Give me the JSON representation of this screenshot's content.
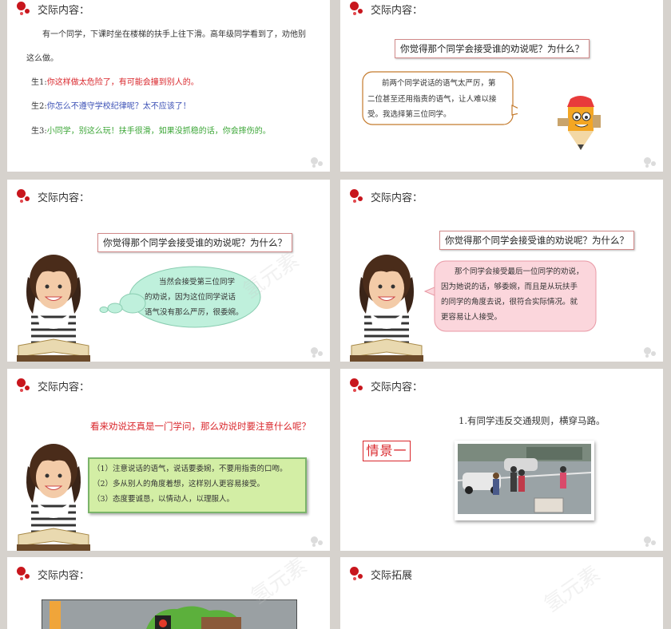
{
  "slides": {
    "s1": {
      "header": "交际内容：",
      "intro_line1": "有一个同学，下课时坐在楼梯的扶手上往下滑。高年级同学看到了，劝他别",
      "intro_line2": "这么做。",
      "s1_label": "生1:",
      "s1_text": "你这样做太危险了，有可能会撞到别人的。",
      "s2_label": "生2:",
      "s2_text": "你怎么不遵守学校纪律呢？太不应该了！",
      "s3_label": "生3:",
      "s3_text": "小同学，别这么玩！扶手很滑，如果没抓稳的话，你会摔伤的。"
    },
    "s2": {
      "header": "交际内容：",
      "question": "你觉得那个同学会接受谁的劝说呢？为什么？",
      "bubble_l1": "前两个同学说话的语气太严厉，第",
      "bubble_l2": "二位甚至还用指责的语气，让人难以接",
      "bubble_l3": "受。我选择第三位同学。"
    },
    "s3": {
      "header": "交际内容：",
      "question": "你觉得那个同学会接受谁的劝说呢？为什么？",
      "cloud_l1": "当然会接受第三位同学",
      "cloud_l2": "的劝说，因为这位同学说话",
      "cloud_l3": "语气没有那么严厉，很委婉。"
    },
    "s4": {
      "header": "交际内容：",
      "question": "你觉得那个同学会接受谁的劝说呢？为什么？",
      "bubble_l1": "那个同学会接受最后一位同学的劝说，",
      "bubble_l2": "因为她说的话，够委婉，而且是从玩扶手",
      "bubble_l3": "的同学的角度去说，很符合实际情况。就",
      "bubble_l4": "更容易让人接受。"
    },
    "s5": {
      "header": "交际内容：",
      "question": "看来劝说还真是一门学问，那么劝说时要注意什么呢？",
      "tip1": "（1）注意说话的语气，说话要委婉，不要用指责的口吻。",
      "tip2": "（2）多从别人的角度着想，这样别人更容易接受。",
      "tip3": "（3）态度要诚恳，以情动人，以理服人。"
    },
    "s6": {
      "header": "交际内容：",
      "scene_label": "情景一",
      "scene_text": "1.有同学违反交通规则，横穿马路。"
    },
    "s7": {
      "header": "交际内容："
    },
    "s8": {
      "header": "交际拓展"
    }
  },
  "watermark_text": "氢元素",
  "colors": {
    "accent_red": "#c8161d",
    "s1_red": "#d9262b",
    "s2_blue": "#3a4fb5",
    "s3_green": "#3aa535"
  }
}
